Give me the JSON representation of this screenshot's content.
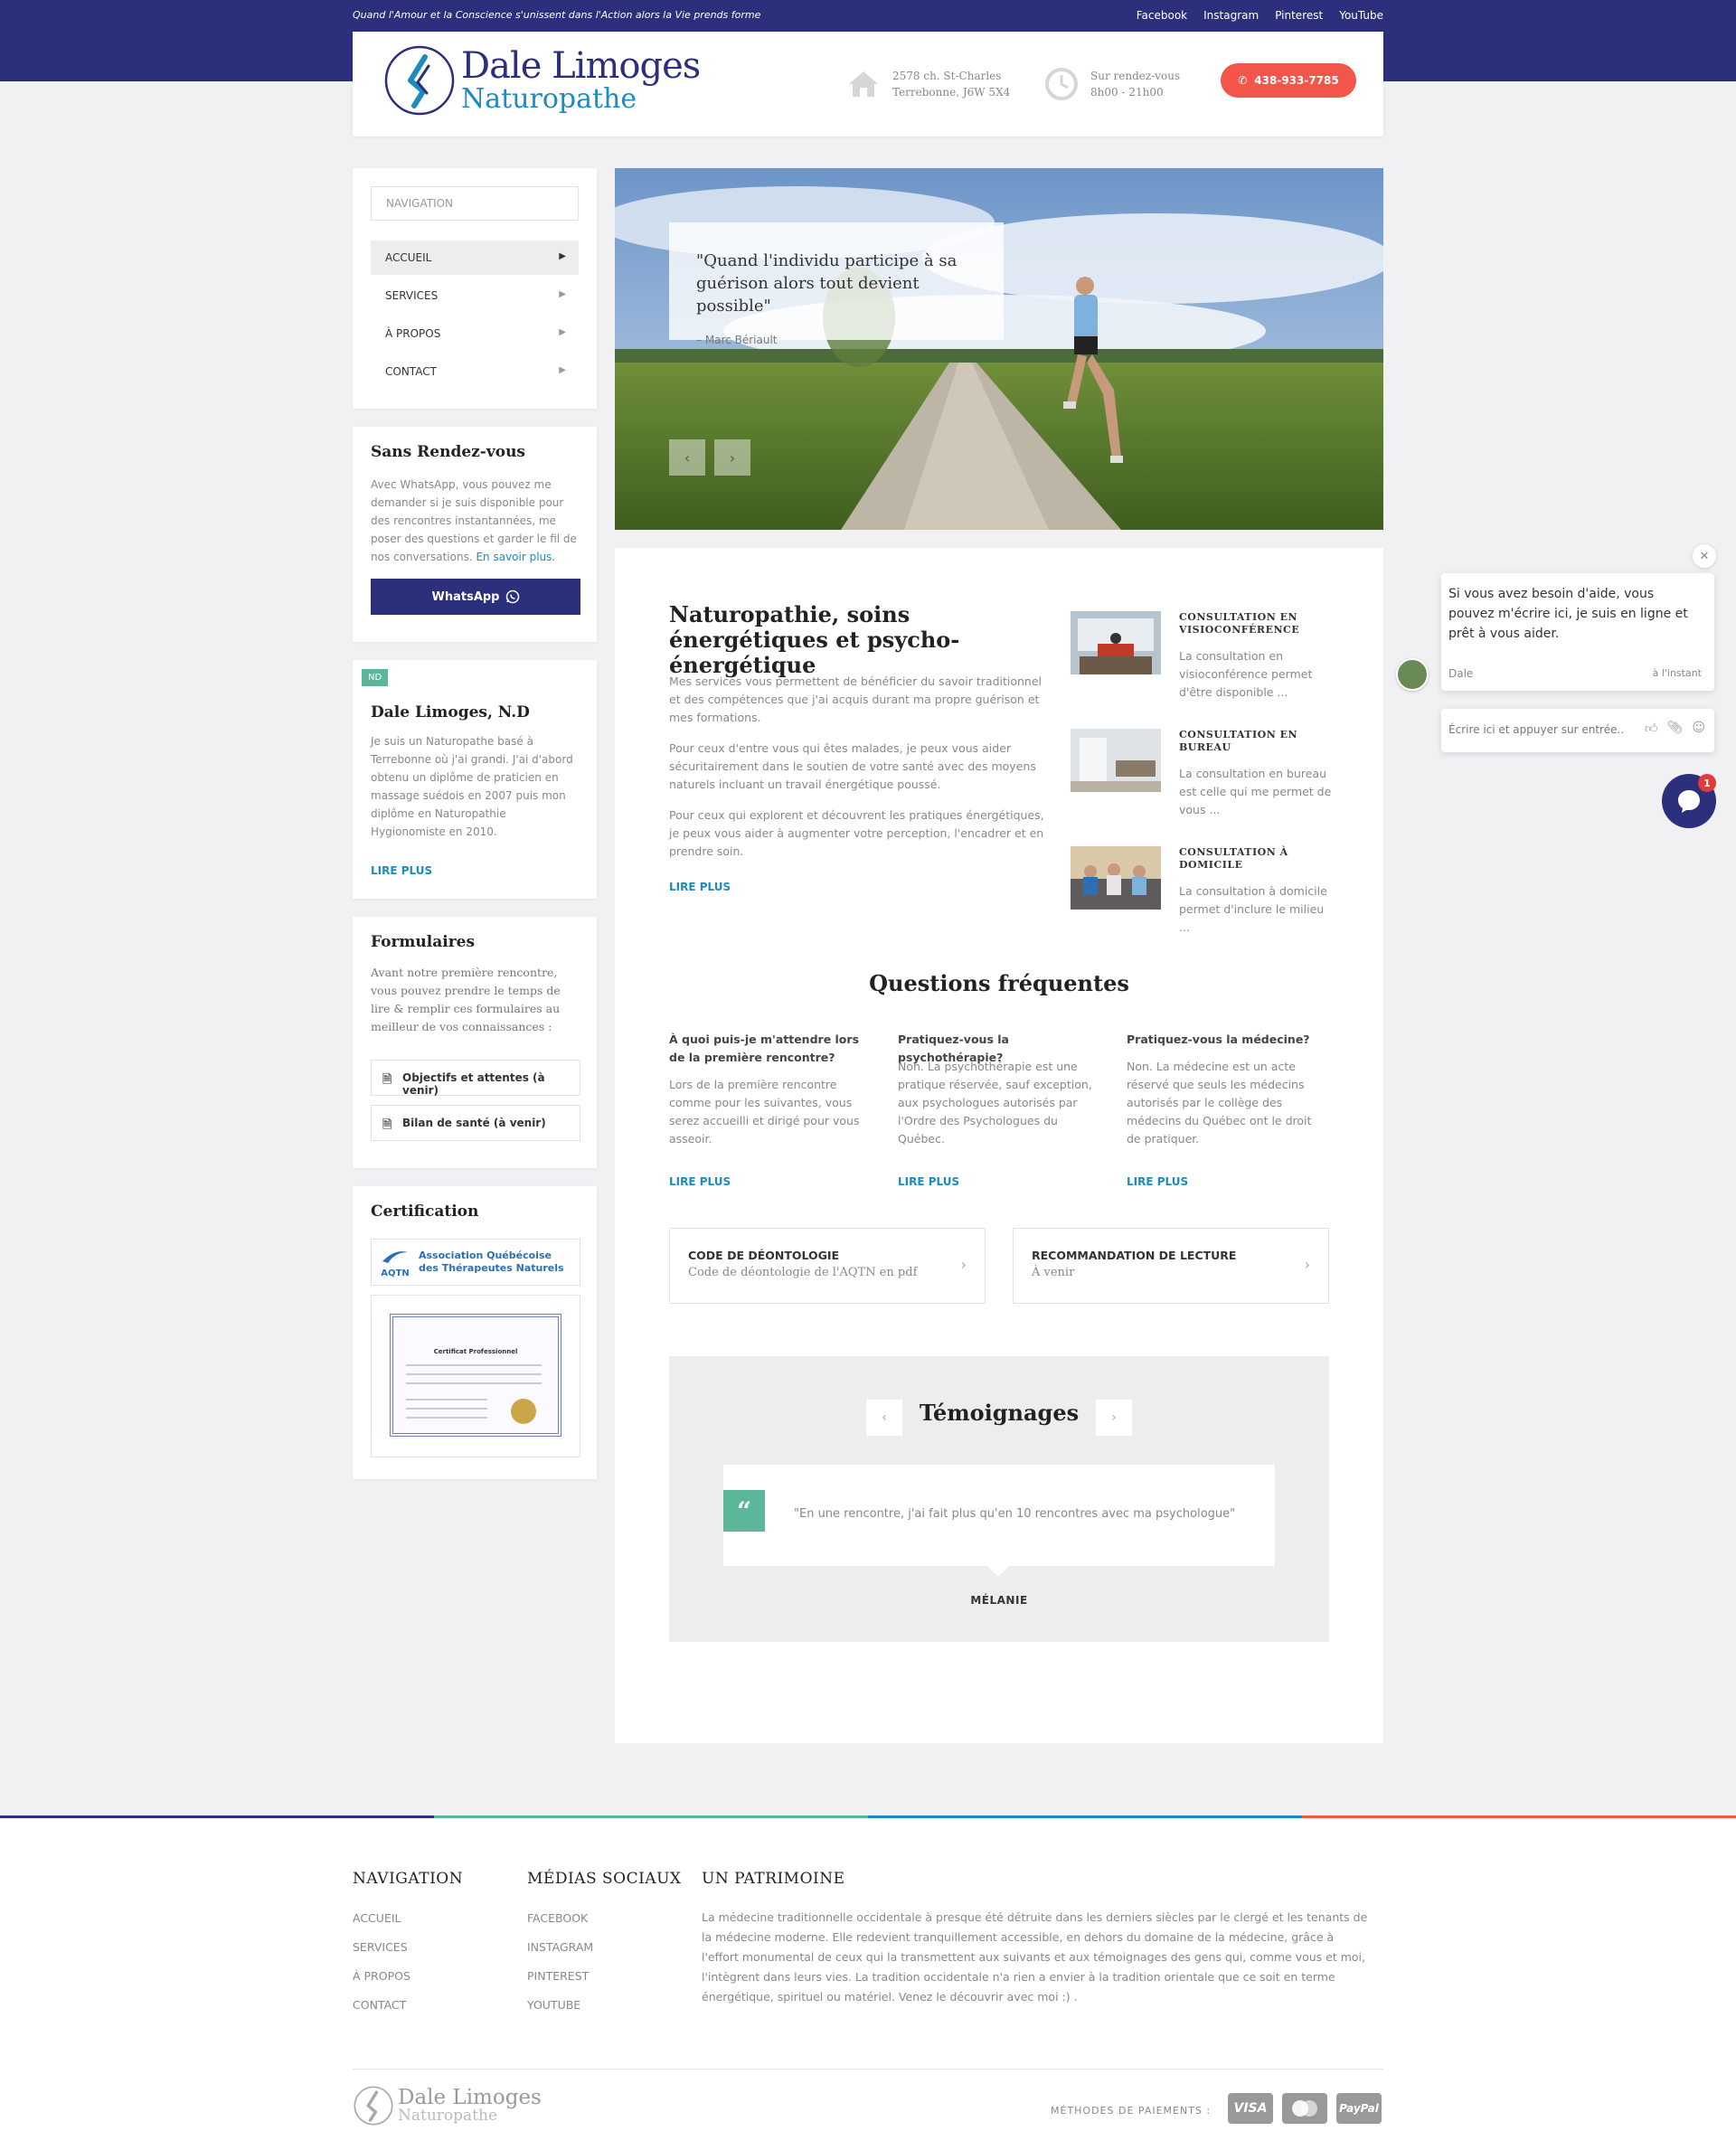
{
  "topbar": {
    "tagline": "Quand l'Amour et la Conscience s'unissent dans l'Action alors la Vie prends forme",
    "social": [
      "Facebook",
      "Instagram",
      "Pinterest",
      "YouTube"
    ]
  },
  "header": {
    "logo_name": "Dale Limoges",
    "logo_sub": "Naturopathe",
    "address_line1": "2578 ch. St-Charles",
    "address_line2": "Terrebonne, J6W 5X4",
    "hours_line1": "Sur rendez-vous",
    "hours_line2": "8h00 - 21h00",
    "phone": "438-933-7785",
    "accent": "#f2564b",
    "brand": "#2b2f7c"
  },
  "sidebar": {
    "nav_title": "NAVIGATION",
    "nav_items": [
      "ACCUEIL",
      "SERVICES",
      "À PROPOS",
      "CONTACT"
    ],
    "walkin_title": "Sans Rendez-vous",
    "walkin_text": "Avec WhatsApp, vous pouvez me demander si je suis disponible pour des rencontres instantannées, me poser des questions et garder le fil de nos conversations.",
    "walkin_link": "En savoir plus.",
    "whatsapp_label": "WhatsApp",
    "about_badge": "ND",
    "about_title": "Dale Limoges, N.D",
    "about_text": "Je suis un Naturopathe basé à Terrebonne où j'ai grandi. J'ai d'abord obtenu un diplôme de praticien en massage suédois en 2007 puis mon diplôme en Naturopathie Hygionomiste en 2010.",
    "about_readmore": "LIRE PLUS",
    "forms_title": "Formulaires",
    "forms_text": "Avant notre première rencontre, vous pouvez prendre le temps de lire & remplir ces formulaires au meilleur de vos connaissances :",
    "form_buttons": [
      "Objectifs et attentes (à venir)",
      "Bilan de santé (à venir)"
    ],
    "cert_title": "Certification",
    "cert_logo_line1": "Association Québécoise",
    "cert_logo_line2": "des Thérapeutes Naturels",
    "cert_logo_abbr": "AQTN",
    "cert_doc_title": "Certificat Professionnel"
  },
  "hero": {
    "quote": "\"Quand l'individu participe à sa guérison alors tout devient possible\"",
    "author": "– Marc Bériault"
  },
  "main": {
    "title": "Naturopathie, soins énergétiques et psycho-énergétique",
    "paragraphs": [
      "Mes services vous permettent de bénéficier du savoir traditionnel et des compétences que j'ai acquis durant ma propre guérison et mes formations.",
      "Pour ceux d'entre vous qui êtes malades, je peux vous aider sécuritairement dans le soutien de votre santé avec des moyens naturels incluant un travail énergétique poussé.",
      "Pour ceux qui explorent et découvrent les pratiques énergétiques, je peux vous aider à augmenter votre perception, l'encadrer et en prendre soin."
    ],
    "readmore": "LIRE PLUS",
    "consults": [
      {
        "title": "CONSULTATION EN VISIOCONFÉRENCE",
        "desc": "La consultation en visioconférence permet d'être disponible ..."
      },
      {
        "title": "CONSULTATION EN BUREAU",
        "desc": "  La consultation en bureau est celle qui me permet de vous ..."
      },
      {
        "title": "CONSULTATION À DOMICILE",
        "desc": "La consultation à domicile permet d'inclure le milieu ..."
      }
    ],
    "faq_title": "Questions fréquentes",
    "faq": [
      {
        "q": "À quoi puis-je m'attendre lors de la première rencontre?",
        "a": "Lors de la première rencontre comme pour les suivantes, vous serez accueilli et dirigé pour vous asseoir.",
        "more": "LIRE PLUS"
      },
      {
        "q": "Pratiquez-vous la psychothérapie?",
        "a": "Non. La psychothérapie est une pratique réservée, sauf exception, aux psychologues autorisés par l'Ordre des Psychologues du Québec.",
        "more": "LIRE PLUS"
      },
      {
        "q": "Pratiquez-vous la médecine?",
        "a": "Non. La médecine est un acte réservé que seuls les médecins autorisés par le collège des médecins du Québec ont le droit de pratiquer.",
        "more": "LIRE PLUS"
      }
    ],
    "docs": [
      {
        "title": "CODE DE DÉONTOLOGIE",
        "sub": "Code de déontologie de l'AQTN en pdf"
      },
      {
        "title": "RECOMMANDATION DE LECTURE",
        "sub": "À venir"
      }
    ],
    "testimonials_title": "Témoignages",
    "testimonial_quote": "\"En une rencontre, j'ai fait plus qu'en 10 rencontres avec ma psychologue\"",
    "testimonial_name": "MÉLANIE"
  },
  "footer": {
    "nav_title": "NAVIGATION",
    "nav_links": [
      "ACCUEIL",
      "SERVICES",
      "À PROPOS",
      "CONTACT"
    ],
    "social_title": "MÉDIAS SOCIAUX",
    "social_links": [
      "FACEBOOK",
      "INSTAGRAM",
      "PINTEREST",
      "YOUTUBE"
    ],
    "heritage_title": "UN PATRIMOINE",
    "heritage_text": "La médecine traditionnelle occidentale à presque été détruite dans les derniers siècles par le clergé et les tenants de la médecine moderne. Elle redevient tranquillement accessible, en dehors du domaine de la médecine, grâce à l'effort monumental de ceux qui la transmettent aux suivants et aux témoignages des gens qui, comme vous et moi, l'intègrent dans leurs vies. La tradition occidentale n'a rien a envier à la tradition orientale que ce soit en terme énergétique, spirituel ou matériel. Venez le découvrir avec moi :) .",
    "logo_name": "Dale Limoges",
    "logo_sub": "Naturopathe",
    "payments_label": "MÉTHODES DE PAIEMENTS :",
    "payments": [
      "VISA",
      "PayPal"
    ]
  },
  "chat": {
    "message": "Si vous avez besoin d'aide, vous pouvez m'écrire ici, je suis en ligne et prêt à vous aider.",
    "agent": "Dale",
    "when": "à l'instant",
    "placeholder": "Écrire ici et appuyer sur entrée..",
    "unread": "1"
  }
}
